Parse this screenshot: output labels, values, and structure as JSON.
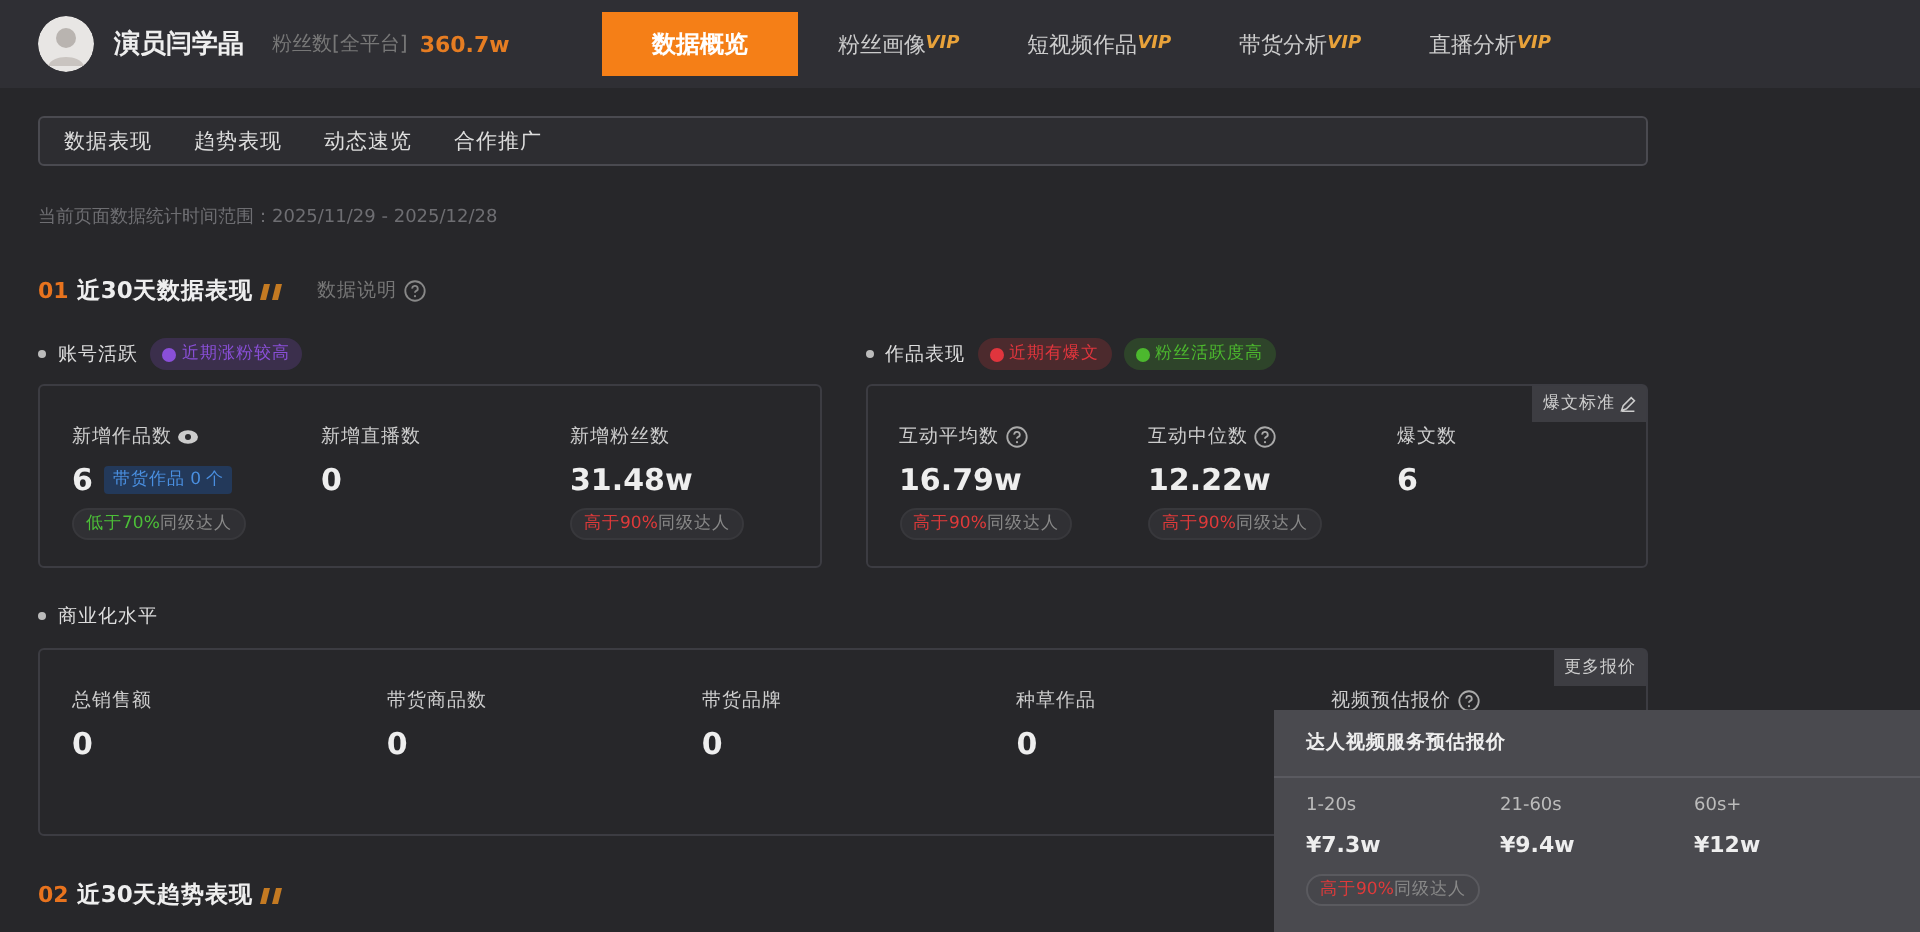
{
  "header": {
    "name": "演员闫学晶",
    "fans_label": "粉丝数[全平台]",
    "fans_value": "360.7w",
    "nav": [
      {
        "label": "数据概览",
        "selected": true
      },
      {
        "label": "粉丝画像",
        "vip": "VIP",
        "selected": false
      },
      {
        "label": "短视频作品",
        "vip": "VIP",
        "selected": false
      },
      {
        "label": "带货分析",
        "vip": "VIP",
        "selected": false
      },
      {
        "label": "直播分析",
        "vip": "VIP",
        "selected": false
      }
    ]
  },
  "subtabs": [
    "数据表现",
    "趋势表现",
    "动态速览",
    "合作推广"
  ],
  "date_range": "当前页面数据统计时间范围：2025/11/29 - 2025/12/28",
  "section1": {
    "num": "01",
    "title": "近30天数据表现",
    "help": "数据说明"
  },
  "account": {
    "title": "账号活跃",
    "tags": [
      {
        "text": "近期涨粉较高",
        "color": "#8a4fd8"
      }
    ],
    "metrics": [
      {
        "kind": "eye",
        "label": "新增作品数",
        "value": "6",
        "extra": "带货作品 0 个",
        "badge": {
          "kind": "low",
          "pct": "低于70%",
          "text": "同级达人"
        }
      },
      {
        "kind": "plain",
        "label": "新增直播数",
        "value": "0"
      },
      {
        "kind": "plain",
        "label": "新增粉丝数",
        "value": "31.48w",
        "badge": {
          "kind": "high",
          "pct": "高于90%",
          "text": "同级达人"
        }
      }
    ]
  },
  "works": {
    "title": "作品表现",
    "tags": [
      {
        "text": "近期有爆文",
        "color": "#e0353d"
      },
      {
        "text": "粉丝活跃度高",
        "color": "#4cb82e"
      }
    ],
    "corner": "爆文标准",
    "metrics": [
      {
        "kind": "help",
        "label": "互动平均数",
        "value": "16.79w",
        "badge": {
          "kind": "high",
          "pct": "高于90%",
          "text": "同级达人"
        }
      },
      {
        "kind": "help",
        "label": "互动中位数",
        "value": "12.22w",
        "badge": {
          "kind": "high",
          "pct": "高于90%",
          "text": "同级达人"
        }
      },
      {
        "kind": "plain",
        "label": "爆文数",
        "value": "6"
      }
    ]
  },
  "commerce": {
    "title": "商业化水平",
    "corner": "更多报价",
    "metrics": [
      {
        "kind": "plain",
        "label": "总销售额",
        "value": "0"
      },
      {
        "kind": "plain",
        "label": "带货商品数",
        "value": "0"
      },
      {
        "kind": "plain",
        "label": "带货品牌",
        "value": "0"
      },
      {
        "kind": "plain",
        "label": "种草作品",
        "value": "0"
      },
      {
        "kind": "help",
        "label": "视频预估报价"
      }
    ]
  },
  "section2": {
    "num": "02",
    "title": "近30天趋势表现"
  },
  "popover": {
    "title": "达人视频服务预估报价",
    "columns": [
      {
        "duration": "1-20s",
        "price": "¥7.3w",
        "badge": {
          "kind": "high",
          "pct": "高于90%",
          "text": "同级达人"
        }
      },
      {
        "duration": "21-60s",
        "price": "¥9.4w"
      },
      {
        "duration": "60s+",
        "price": "¥12w"
      }
    ]
  }
}
